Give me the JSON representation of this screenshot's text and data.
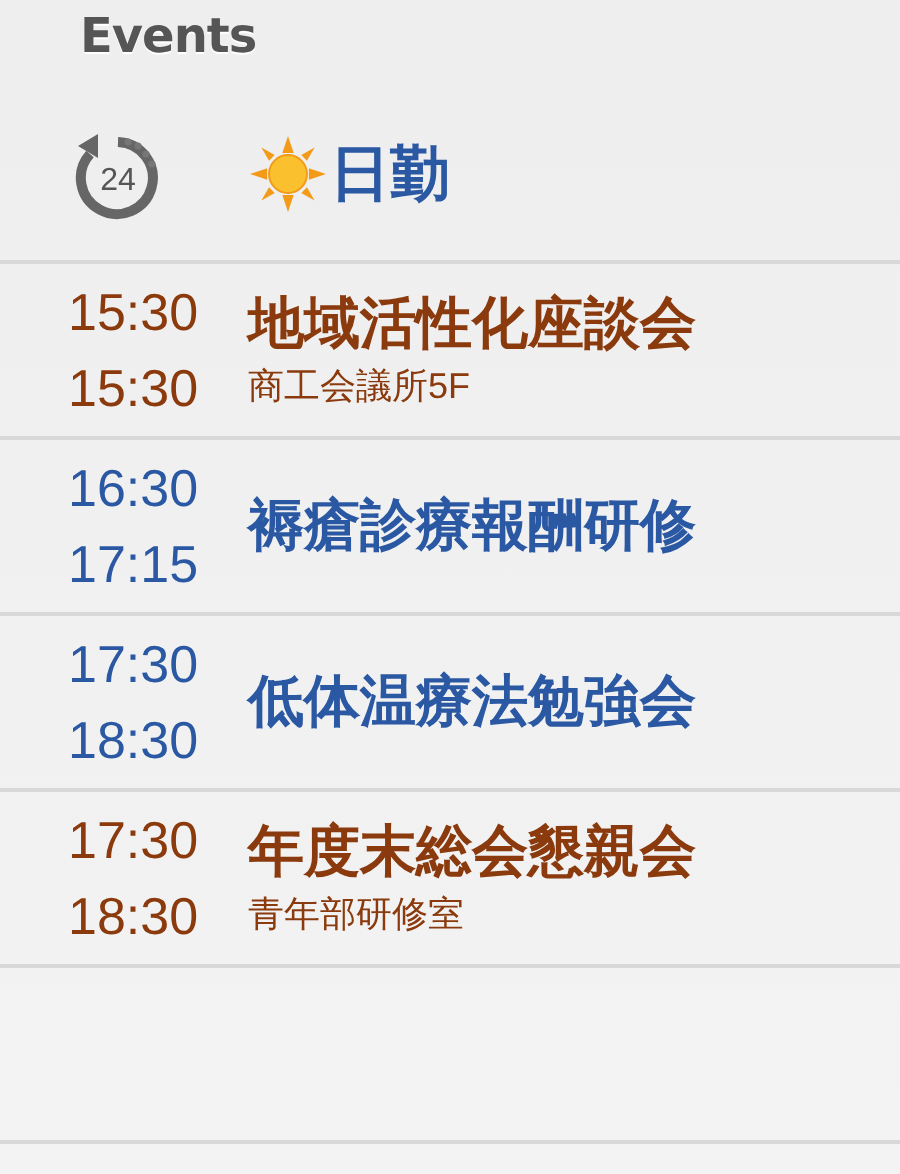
{
  "header": {
    "title": "Events"
  },
  "shift": {
    "badge": "24",
    "label": "日勤"
  },
  "events": [
    {
      "start": "15:30",
      "end": "15:30",
      "title": "地域活性化座談会",
      "location": "商工会議所5F",
      "color": "#8a3a0c"
    },
    {
      "start": "16:30",
      "end": "17:15",
      "title": "褥瘡診療報酬研修",
      "color": "#2b58a3"
    },
    {
      "start": "17:30",
      "end": "18:30",
      "title": "低体温療法勉強会",
      "color": "#2b58a3"
    },
    {
      "start": "17:30",
      "end": "18:30",
      "title": "年度末総会懇親会",
      "location": "青年部研修室",
      "color": "#8a3a0c"
    }
  ]
}
